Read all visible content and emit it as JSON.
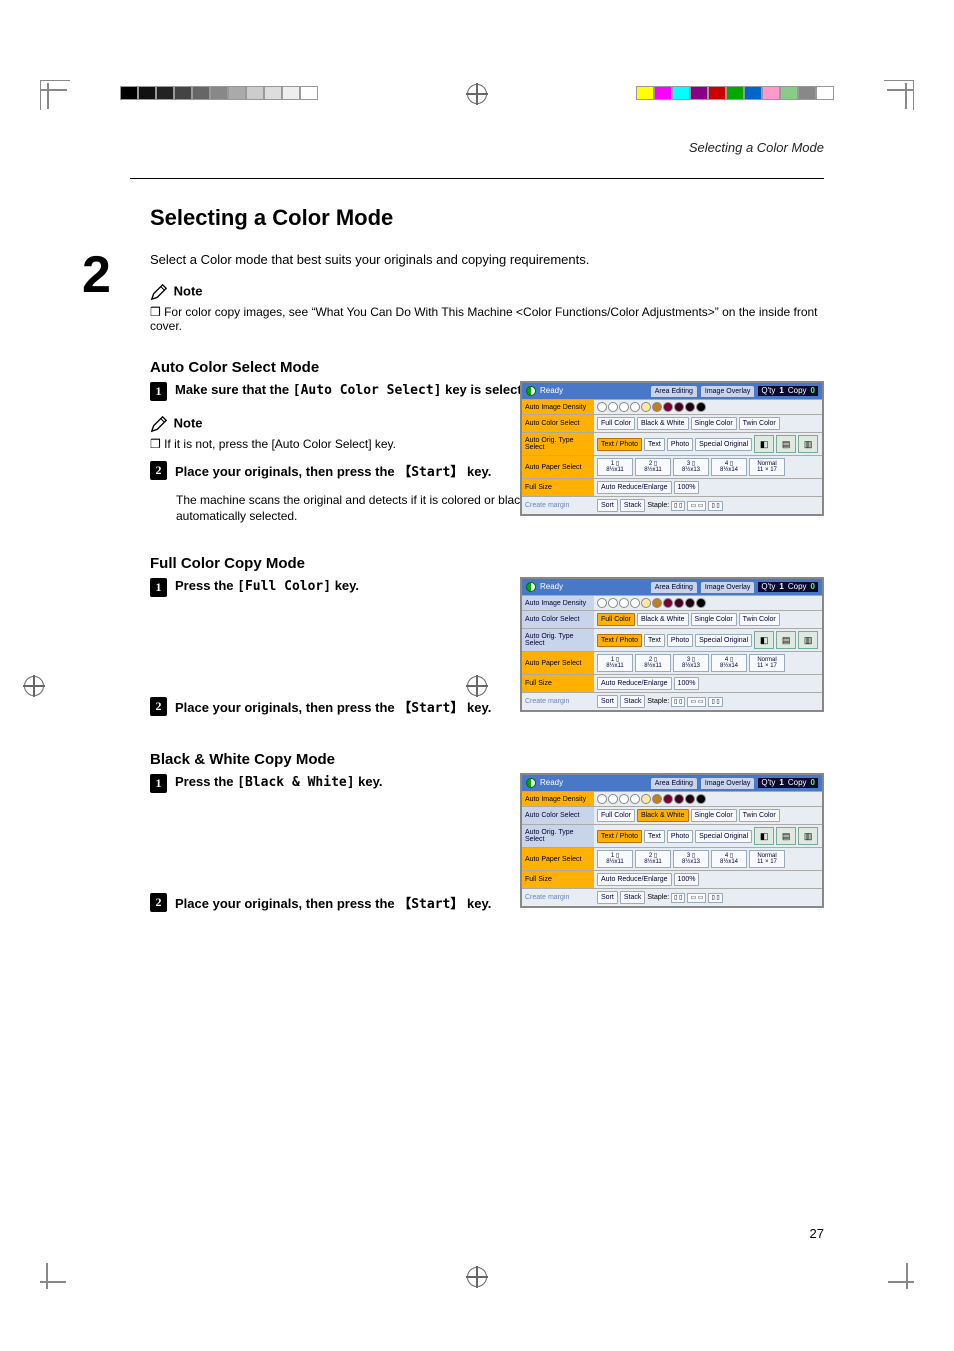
{
  "running_header": "Selecting a Color Mode",
  "section_title": "Selecting a Color Mode",
  "intro": "Select a Color mode that best suits your originals and copying requirements.",
  "note_label": "Note",
  "note_body_1": "For color copy images, see “What You Can Do With This Machine <Color Functions/Color Adjustments>” on the inside front cover.",
  "auto": {
    "title": "Auto Color Select Mode",
    "step1_pre": "Make sure that the ",
    "step1_key": "[Auto Color Select]",
    "step1_post": " key is selected.",
    "note_body": "If it is not, press the [Auto Color Select] key.",
    "step2_pre": "Place your originals, then press the ",
    "step2_key": "【Start】",
    "step2_post": " key.",
    "step2_sub": "The machine scans the original and detects if it is colored or black & white, then the appropriate color mode is automatically selected."
  },
  "full": {
    "title": "Full Color Copy Mode",
    "step1_pre": "Press the ",
    "step1_key": "[Full Color]",
    "step1_post": " key.",
    "step2_pre": "Place your originals, then press the ",
    "step2_key": "【Start】",
    "step2_post": " key."
  },
  "bw": {
    "title": "Black & White Copy Mode",
    "step1_pre": "Press the ",
    "step1_key": "[Black & White]",
    "step1_post": " key.",
    "step2_pre": "Place your originals, then press the ",
    "step2_key": "【Start】",
    "step2_post": " key."
  },
  "mock": {
    "ready": "Ready",
    "area_editing": "Area Editing",
    "image_overlay": "Image Overlay",
    "qty_label": "Q'ty",
    "qty_val": "1",
    "copy_label": "Copy",
    "copy_val": "0",
    "rows": {
      "density": "Auto Image Density",
      "color_select": "Auto Color Select",
      "full_color": "Full Color",
      "bw": "Black & White",
      "single_color": "Single Color",
      "twin_color": "Twin Color",
      "orig_type": "Auto Orig. Type Select",
      "text_photo": "Text / Photo",
      "text": "Text",
      "photo": "Photo",
      "special_original": "Special Original",
      "paper_select": "Auto Paper Select",
      "tray1": "8½x11",
      "tray2": "8½x11",
      "tray3": "8½x13",
      "tray4": "8½x14",
      "tray5a": "Normal",
      "tray5b": "11 × 17",
      "full_size": "Full Size",
      "reduce_enlarge": "Auto Reduce/Enlarge",
      "pct": "100%",
      "create_margin": "Create margin",
      "sort": "Sort",
      "stack": "Stack",
      "staple": "Staple:"
    }
  },
  "page_number": "27",
  "big_margin_num": "2"
}
